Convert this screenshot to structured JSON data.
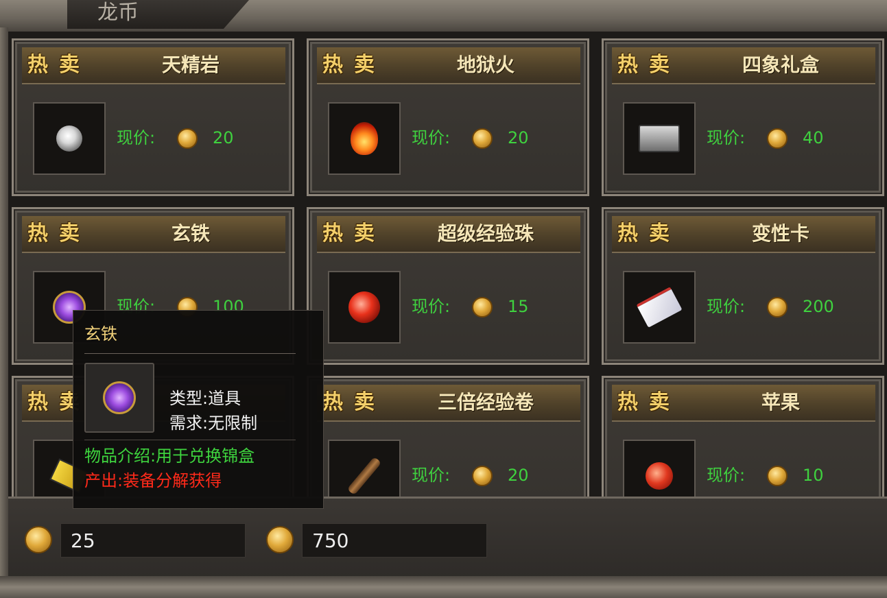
{
  "window": {
    "title": "龙币"
  },
  "hot_label": "热卖",
  "price_label": "现价:",
  "items": [
    {
      "name": "天精岩",
      "price": "20",
      "icon": "white-orb-icon"
    },
    {
      "name": "地狱火",
      "price": "20",
      "icon": "fire-icon"
    },
    {
      "name": "四象礼盒",
      "price": "40",
      "icon": "gift-box-icon"
    },
    {
      "name": "玄铁",
      "price": "100",
      "icon": "purple-gem-icon"
    },
    {
      "name": "超级经验珠",
      "price": "15",
      "icon": "red-orb-icon"
    },
    {
      "name": "变性卡",
      "price": "200",
      "icon": "card-icon"
    },
    {
      "name": "",
      "price": "",
      "icon": "yellow-book-icon"
    },
    {
      "name": "三倍经验卷",
      "price": "20",
      "icon": "scroll-icon"
    },
    {
      "name": "苹果",
      "price": "10",
      "icon": "apple-icon"
    }
  ],
  "balance": {
    "value1": "25",
    "value2": "750"
  },
  "tooltip": {
    "title": "玄铁",
    "type_line": "类型:道具",
    "req_line": "需求:无限制",
    "desc_line": "物品介绍:用于兑换锦盒",
    "source_line": "产出:装备分解获得"
  },
  "colors": {
    "price_green": "#3fd13f",
    "hot_gold": "#f3cf6a",
    "source_red": "#ff2a1a"
  }
}
